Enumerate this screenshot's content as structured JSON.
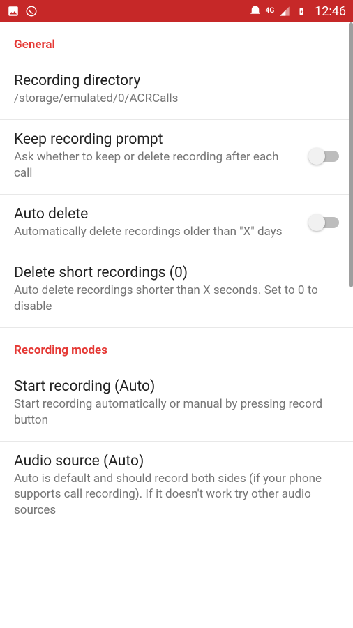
{
  "statusBar": {
    "time": "12:46",
    "network": "4G"
  },
  "sections": {
    "general": {
      "header": "General",
      "items": {
        "recordingDirectory": {
          "title": "Recording directory",
          "subtitle": "/storage/emulated/0/ACRCalls"
        },
        "keepRecording": {
          "title": "Keep recording prompt",
          "subtitle": "Ask whether to keep or delete recording after each call"
        },
        "autoDelete": {
          "title": "Auto delete",
          "subtitle": "Automatically delete recordings older than \"X\" days"
        },
        "deleteShort": {
          "title": "Delete short recordings (0)",
          "subtitle": "Auto delete recordings shorter than X seconds. Set to 0 to disable"
        }
      }
    },
    "recordingModes": {
      "header": "Recording modes",
      "items": {
        "startRecording": {
          "title": "Start recording (Auto)",
          "subtitle": "Start recording automatically or manual by pressing record button"
        },
        "audioSource": {
          "title": "Audio source (Auto)",
          "subtitle": "Auto is default and should record both sides (if your phone supports call recording). If it doesn't work try other audio sources"
        }
      }
    }
  }
}
